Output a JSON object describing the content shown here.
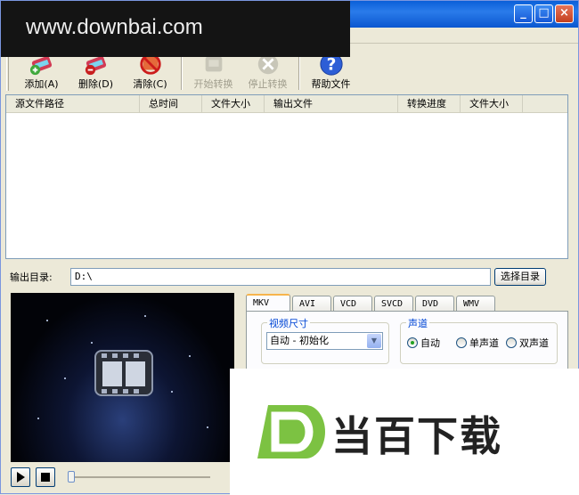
{
  "watermark": {
    "text": "www.downbai.com"
  },
  "window": {
    "controls": [
      "minimize",
      "maximize",
      "close"
    ]
  },
  "toolbar": {
    "buttons": [
      {
        "label": "添加(A)",
        "icon": "add-icon",
        "enabled": true
      },
      {
        "label": "删除(D)",
        "icon": "delete-icon",
        "enabled": true
      },
      {
        "label": "清除(C)",
        "icon": "clear-icon",
        "enabled": true
      },
      {
        "label": "开始转换",
        "icon": "start-convert-icon",
        "enabled": false
      },
      {
        "label": "停止转换",
        "icon": "stop-convert-icon",
        "enabled": false
      },
      {
        "label": "帮助文件",
        "icon": "help-icon",
        "enabled": true
      }
    ]
  },
  "file_list": {
    "columns": [
      "源文件路径",
      "总时间",
      "文件大小",
      "输出文件",
      "转换进度",
      "文件大小"
    ],
    "rows": []
  },
  "output": {
    "label": "输出目录:",
    "value": "D:\\",
    "browse_label": "选择目录"
  },
  "format_tabs": [
    {
      "label": "MKV",
      "active": true
    },
    {
      "label": "AVI",
      "active": false
    },
    {
      "label": "VCD",
      "active": false
    },
    {
      "label": "SVCD",
      "active": false
    },
    {
      "label": "DVD",
      "active": false
    },
    {
      "label": "WMV",
      "active": false
    }
  ],
  "video_size": {
    "title": "视频尺寸",
    "selected": "自动 - 初始化"
  },
  "audio_channel": {
    "title": "声道",
    "options": [
      "自动",
      "单声道",
      "双声道"
    ],
    "selected": "自动"
  },
  "logo_overlay": {
    "text": "当百下载",
    "letter": "D"
  },
  "colors": {
    "logo_green": "#7cc242",
    "group_title": "#0046d5",
    "tab_highlight": "#f7b44c"
  }
}
